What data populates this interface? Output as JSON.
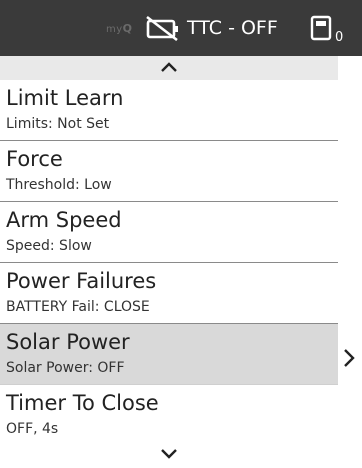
{
  "status_bar": {
    "logo_prefix": "my",
    "logo_suffix": "Q",
    "ttc_status": "TTC - OFF",
    "device_count": "0",
    "icons": [
      "battery-off-icon",
      "device-icon"
    ]
  },
  "menu": {
    "items": [
      {
        "title": "Limit Learn",
        "subtitle": "Limits: Not Set"
      },
      {
        "title": "Force",
        "subtitle": "Threshold: Low"
      },
      {
        "title": "Arm Speed",
        "subtitle": "Speed: Slow"
      },
      {
        "title": "Power Failures",
        "subtitle": "BATTERY Fail: CLOSE"
      },
      {
        "title": "Solar Power",
        "subtitle": "Solar Power: OFF",
        "selected": true
      },
      {
        "title": "Timer To Close",
        "subtitle": "OFF, 4s"
      }
    ]
  },
  "colors": {
    "status_bar_bg": "#3a3a3a",
    "selected_row_bg": "#d9d9d9",
    "scroll_bar_bg": "#e9e9e9"
  }
}
